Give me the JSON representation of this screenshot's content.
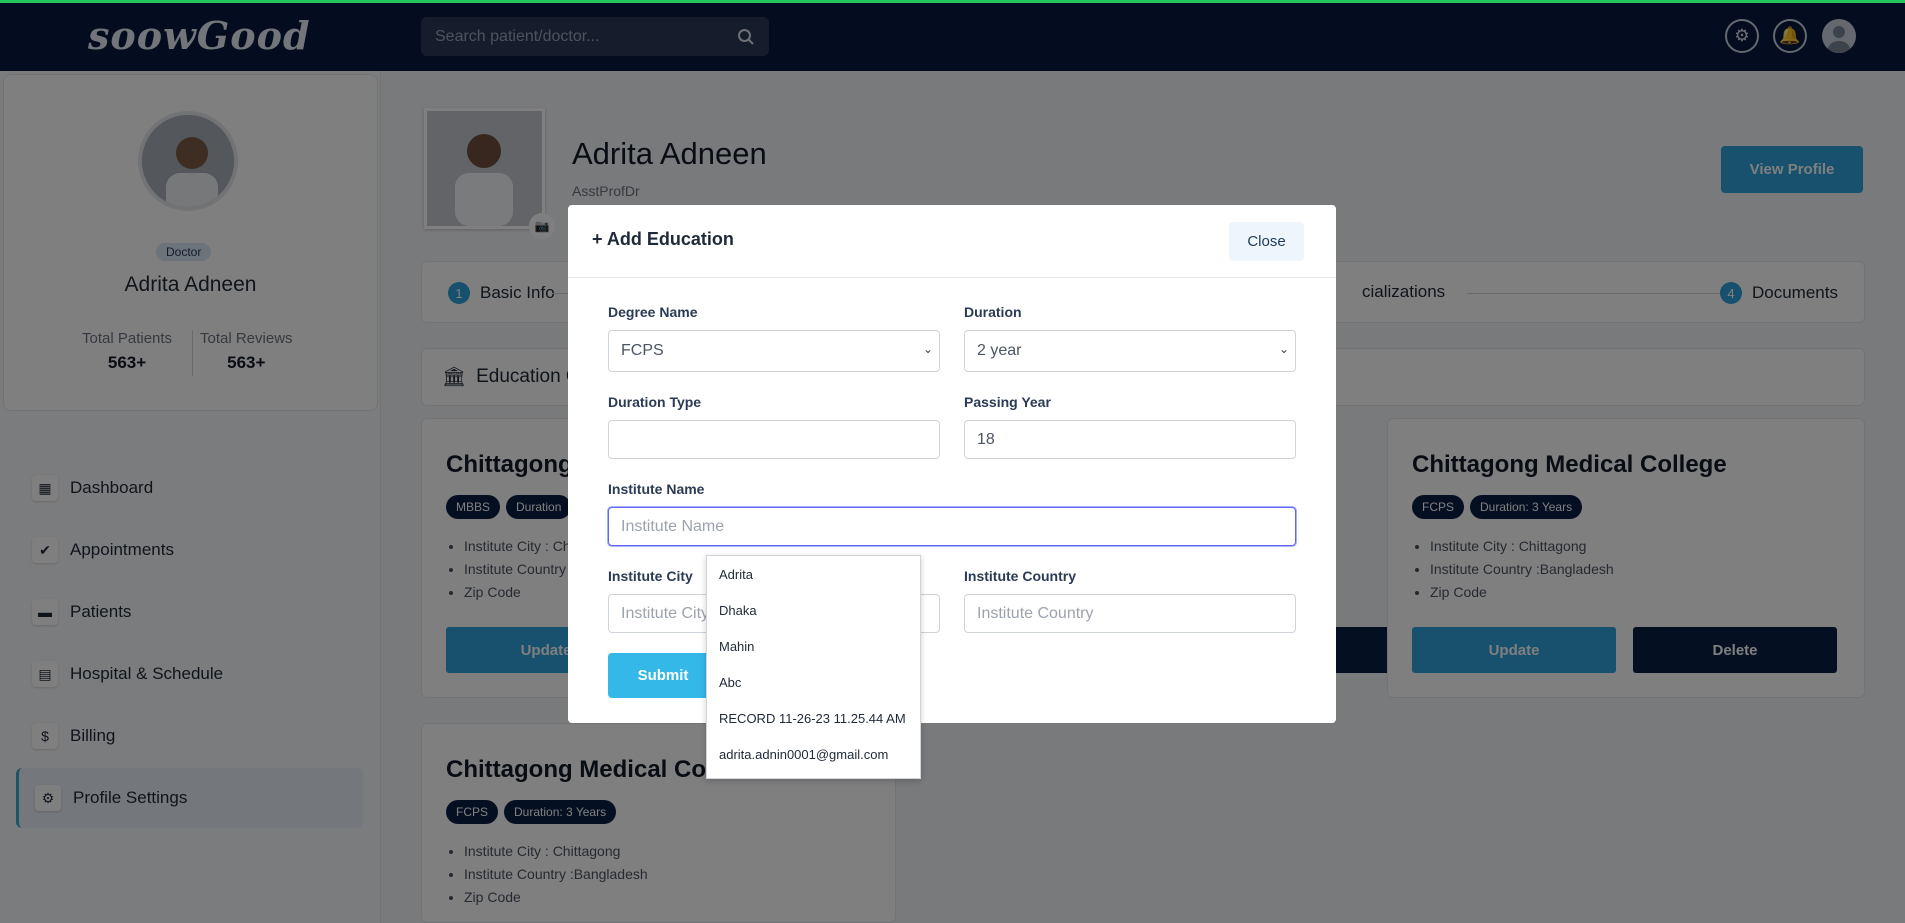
{
  "header": {
    "logo": "soowGood",
    "search_placeholder": "Search patient/doctor...",
    "icons": [
      "settings-icon",
      "bell-icon",
      "user-avatar"
    ]
  },
  "sidebar": {
    "role_badge": "Doctor",
    "name": "Adrita Adneen",
    "stats": [
      {
        "label": "Total Patients",
        "value": "563+"
      },
      {
        "label": "Total Reviews",
        "value": "563+"
      }
    ],
    "nav": [
      {
        "label": "Dashboard",
        "icon": "dashboard-icon"
      },
      {
        "label": "Appointments",
        "icon": "calendar-check-icon"
      },
      {
        "label": "Patients",
        "icon": "bed-icon"
      },
      {
        "label": "Hospital & Schedule",
        "icon": "calendar-icon"
      },
      {
        "label": "Billing",
        "icon": "money-icon"
      },
      {
        "label": "Profile Settings",
        "icon": "gear-icon",
        "active": true
      }
    ]
  },
  "profile": {
    "name": "Adrita Adneen",
    "title": "AsstProfDr",
    "view_profile": "View Profile"
  },
  "steps": [
    {
      "num": "1",
      "label": "Basic Info"
    },
    {
      "num": "",
      "label": "cializations"
    },
    {
      "num": "4",
      "label": "Documents"
    }
  ],
  "education_section": {
    "title": "Education Qu"
  },
  "cards": [
    {
      "title": "Chittagong",
      "tags": [
        "MBBS",
        "Duration"
      ],
      "items": [
        "Institute City : Ch",
        "Institute Country",
        "Zip Code"
      ],
      "update": "Update"
    },
    {
      "title": "Chittagong Medical College",
      "tags": [
        "FCPS",
        "Duration: 3 Years"
      ],
      "items": [
        "Institute City : Chittagong",
        "Institute Country :Bangladesh",
        "Zip Code"
      ],
      "update": "Update",
      "delete": "Delete"
    },
    {
      "title": "Chittagong Medical Coll",
      "tags": [
        "FCPS",
        "Duration: 3 Years"
      ],
      "items": [
        "Institute City : Chittagong",
        "Institute Country :Bangladesh",
        "Zip Code"
      ]
    }
  ],
  "modal": {
    "title": "Add Education",
    "close": "Close",
    "degree_label": "Degree Name",
    "degree_value": "FCPS",
    "duration_label": "Duration",
    "duration_value": "2 year",
    "duration_type_label": "Duration Type",
    "duration_type_value": "",
    "passing_year_label": "Passing Year",
    "passing_year_value": "18",
    "institute_label": "Institute Name",
    "institute_placeholder": "Institute Name",
    "city_label": "Institute City",
    "city_placeholder": "Institute City",
    "country_label": "Institute Country",
    "country_placeholder": "Institute Country",
    "submit": "Submit"
  },
  "autocomplete": [
    "Adrita",
    "Dhaka",
    "Mahin",
    "Abc",
    "RECORD 11-26-23 11.25.44 AM",
    "adrita.adnin0001@gmail.com"
  ]
}
